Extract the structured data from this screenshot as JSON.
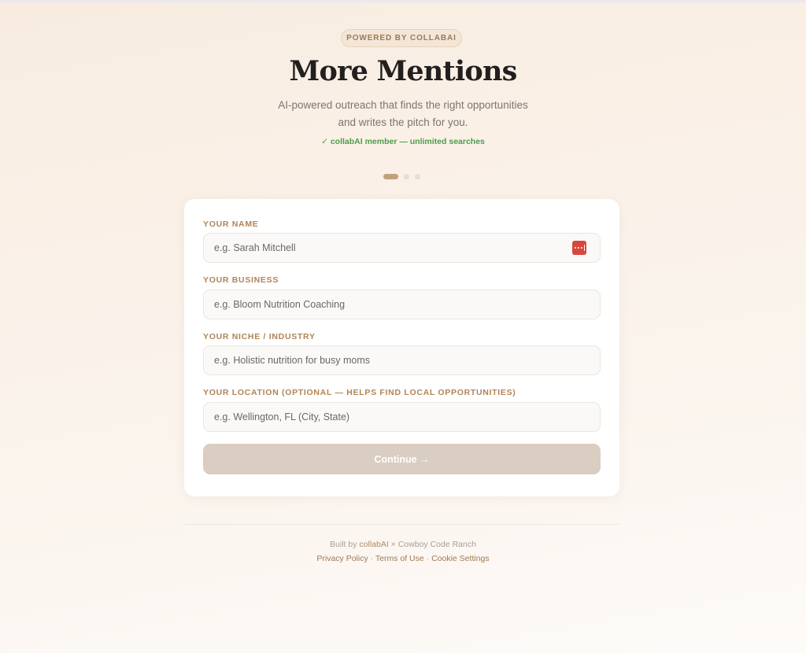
{
  "header": {
    "badge": "POWERED BY COLLABAI",
    "title": "More Mentions",
    "subtitle_line1": "AI-powered outreach that finds the right opportunities",
    "subtitle_line2": "and writes the pitch for you.",
    "member_status": "✓ collabAI member — unlimited searches"
  },
  "progress": {
    "current_step": 1,
    "total_steps": 3
  },
  "form": {
    "fields": [
      {
        "label": "YOUR NAME",
        "placeholder": "e.g. Sarah Mitchell",
        "value": ""
      },
      {
        "label": "YOUR BUSINESS",
        "placeholder": "e.g. Bloom Nutrition Coaching",
        "value": ""
      },
      {
        "label": "YOUR NICHE / INDUSTRY",
        "placeholder": "e.g. Holistic nutrition for busy moms",
        "value": ""
      },
      {
        "label": "YOUR LOCATION (OPTIONAL — HELPS FIND LOCAL OPPORTUNITIES)",
        "placeholder": "e.g. Wellington, FL (City, State)",
        "value": ""
      }
    ],
    "password_manager_icon": "password-manager-icon",
    "continue_label": "Continue →"
  },
  "footer": {
    "built_prefix": "Built by ",
    "built_brand": "collabAI",
    "built_suffix": " × Cowboy Code Ranch",
    "links": [
      "Privacy Policy",
      "Terms of Use",
      "Cookie Settings"
    ],
    "separator": " · "
  },
  "colors": {
    "accent": "#b08456",
    "member_green": "#4c9d4c",
    "continue_disabled": "#dacdc1",
    "password_icon": "#d8473b"
  }
}
